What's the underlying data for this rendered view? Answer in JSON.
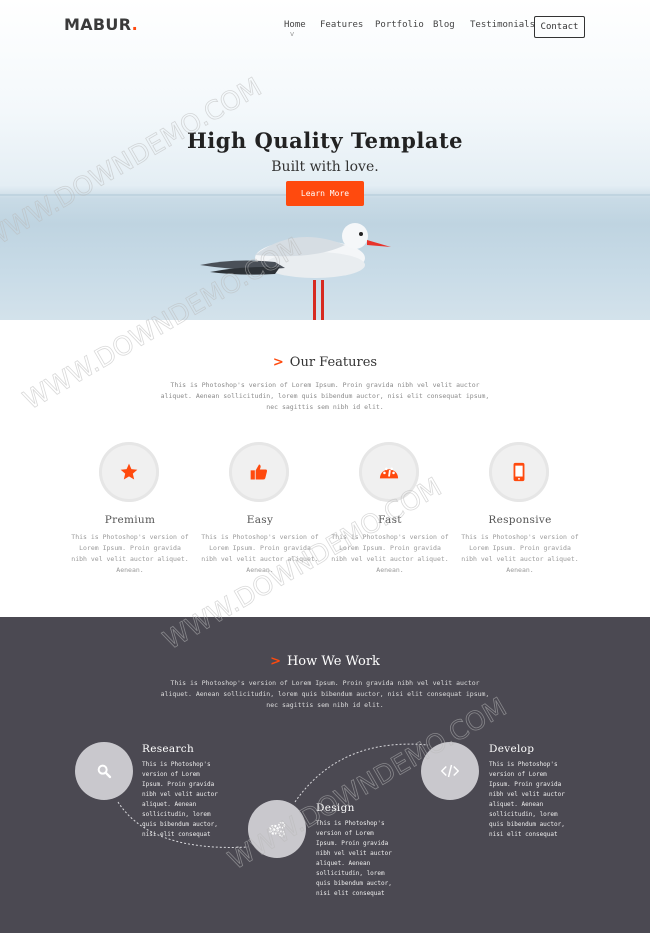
{
  "header": {
    "logo": "MABUR",
    "logo_dot": ".",
    "nav": [
      "Home",
      "Features",
      "Portfolio",
      "Blog",
      "Testimonials"
    ],
    "active_indicator": "v",
    "contact_label": "Contact"
  },
  "hero": {
    "title": "High Quality Template",
    "subtitle": "Built with love.",
    "cta": "Learn More"
  },
  "features": {
    "title": "Our Features",
    "chevron": ">",
    "desc": "This is Photoshop's version of Lorem Ipsum. Proin gravida nibh vel velit auctor aliquet. Aenean sollicitudin, lorem quis bibendum auctor, nisi elit consequat ipsum, nec sagittis sem nibh id elit.",
    "items": [
      {
        "title": "Premium",
        "icon": "star-icon",
        "text": "This is Photoshop's version of Lorem Ipsum. Proin gravida nibh vel velit auctor aliquet. Aenean."
      },
      {
        "title": "Easy",
        "icon": "thumbs-up-icon",
        "text": "This is Photoshop's version of Lorem Ipsum. Proin gravida nibh vel velit auctor aliquet. Aenean."
      },
      {
        "title": "Fast",
        "icon": "dashboard-icon",
        "text": "This is Photoshop's version of Lorem Ipsum. Proin gravida nibh vel velit auctor aliquet. Aenean."
      },
      {
        "title": "Responsive",
        "icon": "mobile-icon",
        "text": "This is Photoshop's version of Lorem Ipsum. Proin gravida nibh vel velit auctor aliquet. Aenean."
      }
    ]
  },
  "work": {
    "title": "How We Work",
    "chevron": ">",
    "desc": "This is Photoshop's version of Lorem Ipsum. Proin gravida nibh vel velit auctor aliquet. Aenean sollicitudin, lorem quis bibendum auctor, nisi elit consequat ipsum, nec sagittis sem nibh id elit.",
    "steps": [
      {
        "title": "Research",
        "icon": "search-icon",
        "text": "This is Photoshop's version of Lorem Ipsum. Proin gravida nibh vel velit auctor aliquet. Aenean sollicitudin, lorem quis bibendum auctor, nisi elit consequat"
      },
      {
        "title": "Design",
        "icon": "gears-icon",
        "text": "This is Photoshop's version of Lorem Ipsum. Proin gravida nibh vel velit auctor aliquet. Aenean sollicitudin, lorem quis bibendum auctor, nisi elit consequat"
      },
      {
        "title": "Develop",
        "icon": "code-icon",
        "text": "This is Photoshop's version of Lorem Ipsum. Proin gravida nibh vel velit auctor aliquet. Aenean sollicitudin, lorem quis bibendum auctor, nisi elit consequat"
      }
    ]
  },
  "watermark": "WWW.DOWNDEMO.COM",
  "colors": {
    "accent": "#ff4a0e",
    "dark_section": "#4b4952",
    "step_circle": "#c9c8cd"
  }
}
